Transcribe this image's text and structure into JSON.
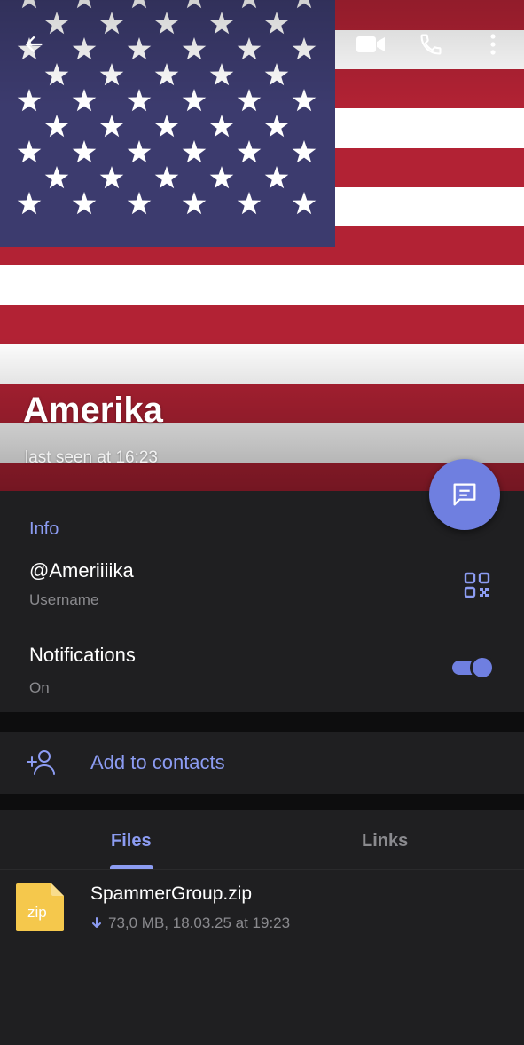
{
  "header": {
    "title": "Amerika",
    "status": "last seen at 16:23"
  },
  "info": {
    "section_title": "Info",
    "username": "@Ameriiiika",
    "username_label": "Username",
    "notifications_title": "Notifications",
    "notifications_state": "On",
    "notifications_enabled": true
  },
  "contacts": {
    "add_label": "Add to contacts"
  },
  "media": {
    "tabs": [
      {
        "label": "Files",
        "active": true
      },
      {
        "label": "Links",
        "active": false
      }
    ],
    "files": [
      {
        "icon_label": "zip",
        "name": "SpammerGroup.zip",
        "meta": "73,0 MB, 18.03.25 at 19:23"
      }
    ]
  },
  "colors": {
    "accent": "#8c9cf2",
    "fab": "#6f7fe0",
    "panel": "#1f1f21",
    "file_icon": "#f5c84c"
  },
  "icons": {
    "back": "arrow-left-icon",
    "video": "video-camera-icon",
    "call": "phone-icon",
    "more": "more-vertical-icon",
    "fab": "message-icon",
    "qr": "qr-code-icon",
    "add_contact": "add-user-icon",
    "download": "download-arrow-icon"
  }
}
